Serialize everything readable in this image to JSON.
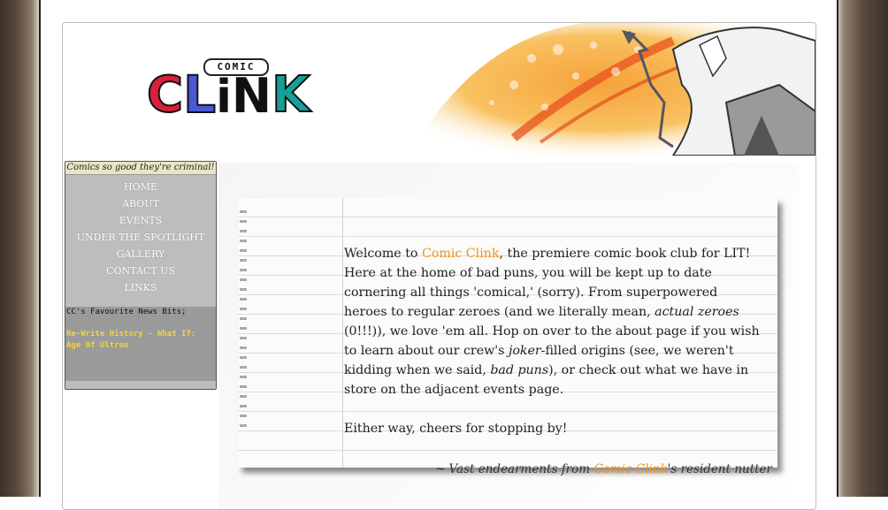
{
  "logo": {
    "small_text": "COMIC",
    "big_text": [
      "C",
      "L",
      "i",
      "N",
      "K"
    ]
  },
  "sidebar": {
    "tagline": "Comics so good they're criminal!",
    "nav": [
      "HOME",
      "ABOUT",
      "EVENTS",
      "UNDER THE SPOTLIGHT",
      "GALLERY",
      "CONTACT US",
      "LINKS"
    ],
    "news_title": "CC's Favourite News Bits;",
    "news_link": "Re-Write History - What If: Age Of Ultron"
  },
  "main": {
    "welcome_pre": "Welcome to ",
    "brand": "Comic Clink",
    "welcome_post": ", the premiere comic book club for LIT! Here at the home of bad puns, you will be kept up to date cornering all things 'comical,' (sorry). From superpowered heroes to regular zeroes (and we literally mean, ",
    "em1": "actual zeroes",
    "part2": " (0!!!)), we love 'em all. Hop on over to the about page if you wish to learn about our crew's ",
    "em2": "joker",
    "part3": "-filled origins (see, we weren't kidding when we said, ",
    "em3": "bad puns",
    "part4": "), or check out what we have in store on the adjacent events page.",
    "para2": "Either way, cheers for stopping by!",
    "sign_pre": "~ Vast endearments from ",
    "sign_brand": "Comic Clink",
    "sign_post": "'s resident nutter"
  },
  "colors": {
    "brand_orange": "#f0941a",
    "news_link": "#f3d43c",
    "sidebar_bg": "#bdbdbd"
  }
}
